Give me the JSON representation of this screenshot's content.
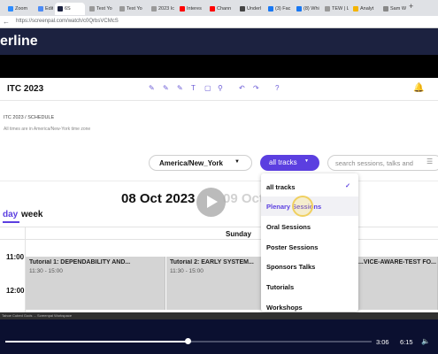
{
  "browser": {
    "tabs": [
      {
        "label": "Zoom",
        "color": "#2d8cff"
      },
      {
        "label": "Edit P",
        "color": "#4c8bf5"
      },
      {
        "label": "6S",
        "color": "#1c2240",
        "active": true
      },
      {
        "label": "Test Yo",
        "color": "#999999"
      },
      {
        "label": "Test Yo",
        "color": "#999999"
      },
      {
        "label": "2023 Ic",
        "color": "#999999"
      },
      {
        "label": "Interes",
        "color": "#ff0000"
      },
      {
        "label": "Chann",
        "color": "#ff0000"
      },
      {
        "label": "Underl",
        "color": "#444444"
      },
      {
        "label": "(3) Fac",
        "color": "#1877f2"
      },
      {
        "label": "(8) Whi",
        "color": "#1877f2"
      },
      {
        "label": "TEW | L",
        "color": "#999999"
      },
      {
        "label": "Analyt",
        "color": "#f4b400"
      },
      {
        "label": "Sam W",
        "color": "#888888"
      }
    ],
    "url": "https://screenpal.com/watch/c0QrbsVCMcS"
  },
  "screenpal": {
    "brand": "erline"
  },
  "app": {
    "title": "ITC 2023",
    "breadcrumb": "ITC 2023 / SCHEDULE",
    "tz_note": "All times are in America/New-York time zone",
    "tz_value": "America/New_York",
    "tracks_label": "all tracks",
    "search_placeholder": "search sessions, talks and",
    "date_heading": "08 Oct 2023",
    "next_date": "09 Oct",
    "view_day": "day",
    "view_week": "week",
    "day_column": "Sunday",
    "times": [
      "11:00",
      "12:00"
    ],
    "events": [
      {
        "title": "Tutorial 1: DEPENDABILITY AND...",
        "time": "11:30 - 15:00"
      },
      {
        "title": "Tutorial 2: EARLY SYSTEM...",
        "time": "11:30 - 15:00"
      },
      {
        "title": "...VICE-AWARE-TEST FO...",
        "time": ""
      }
    ],
    "dropdown": [
      {
        "label": "all tracks",
        "checked": true
      },
      {
        "label": "Plenary Sessions",
        "highlighted": true
      },
      {
        "label": "Oral Sessions"
      },
      {
        "label": "Poster Sessions"
      },
      {
        "label": "Sponsors Talks"
      },
      {
        "label": "Tutorials"
      },
      {
        "label": "Workshops"
      }
    ],
    "accent": "#5b3fe0"
  },
  "taskbar": {
    "text": "Tahoe Cubed Gods ... Screenpal Workspace"
  },
  "player": {
    "current": "3:06",
    "total": "6:15",
    "progress": 0.4987
  }
}
